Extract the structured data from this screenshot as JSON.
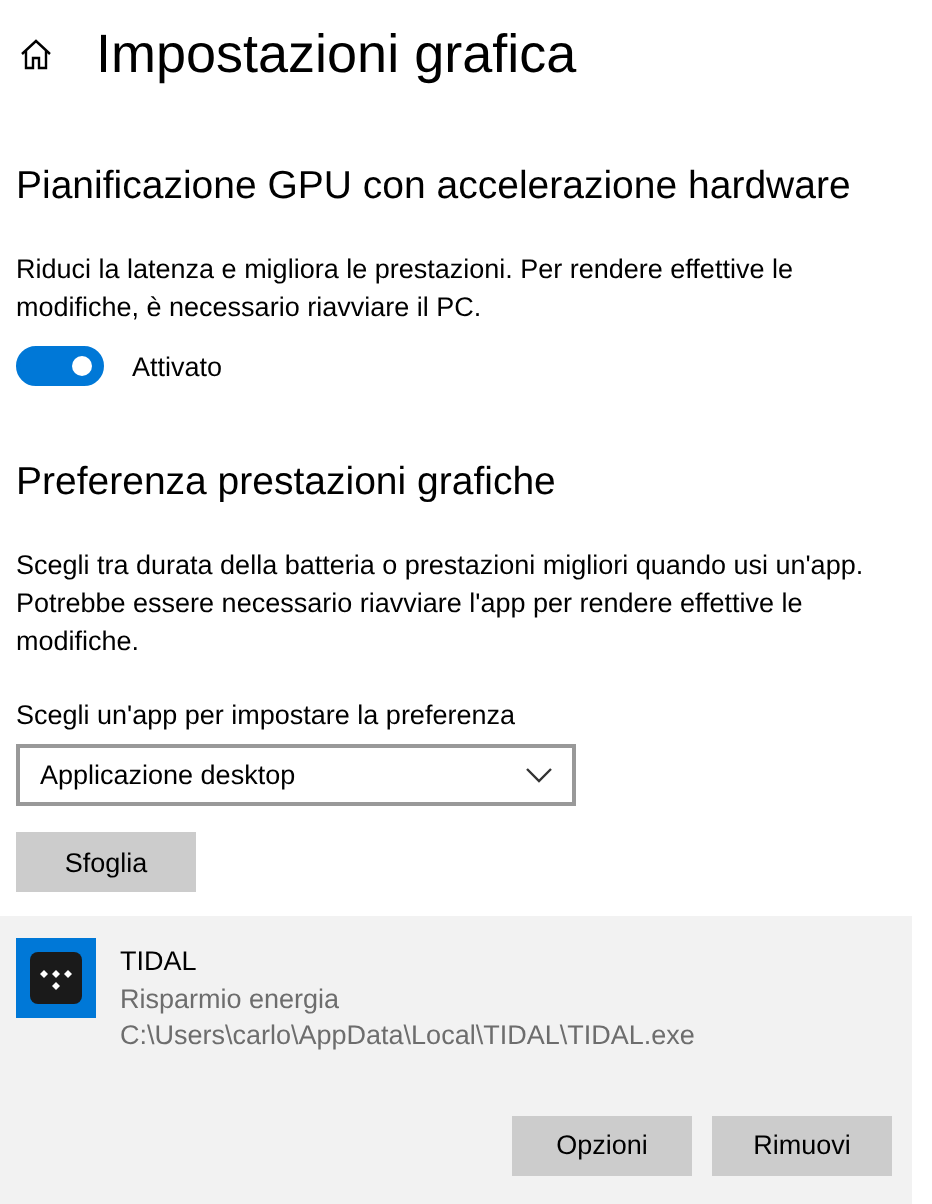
{
  "header": {
    "title": "Impostazioni grafica"
  },
  "gpu_section": {
    "heading": "Pianificazione GPU con accelerazione hardware",
    "description": "Riduci la latenza e migliora le prestazioni. Per rendere effettive le modifiche, è necessario riavviare il PC.",
    "toggle": {
      "on": true,
      "label": "Attivato"
    }
  },
  "preference_section": {
    "heading": "Preferenza prestazioni grafiche",
    "description": "Scegli tra durata della batteria o prestazioni migliori quando usi un'app. Potrebbe essere necessario riavviare l'app per rendere effettive le modifiche.",
    "select_label": "Scegli un'app per impostare la preferenza",
    "select_value": "Applicazione desktop",
    "browse_button": "Sfoglia"
  },
  "apps": [
    {
      "name": "TIDAL",
      "preference": "Risparmio energia",
      "path": "C:\\Users\\carlo\\AppData\\Local\\TIDAL\\TIDAL.exe",
      "selected": true,
      "buttons": [
        "Opzioni",
        "Rimuovi"
      ]
    }
  ]
}
